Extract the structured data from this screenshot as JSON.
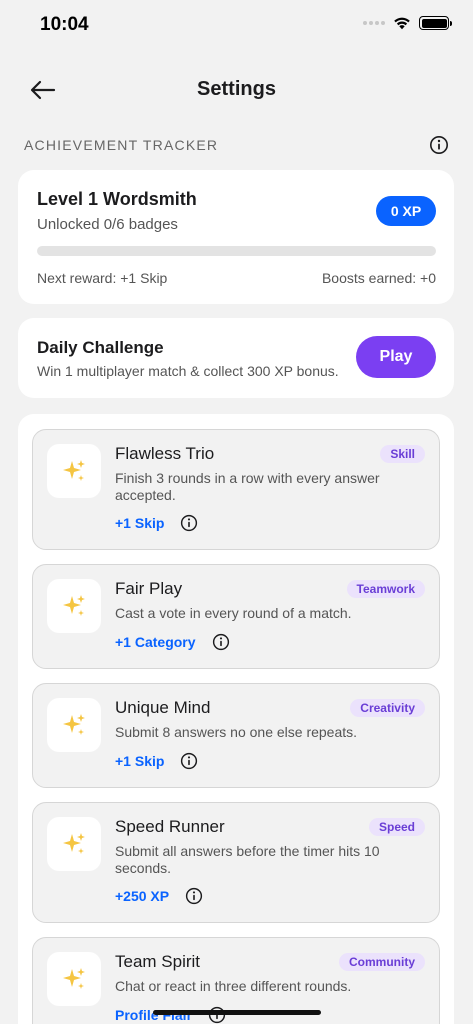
{
  "status_bar": {
    "time": "10:04"
  },
  "nav": {
    "title": "Settings"
  },
  "section": {
    "title": "ACHIEVEMENT TRACKER"
  },
  "tracker": {
    "title": "Level 1 Wordsmith",
    "subtitle": "Unlocked 0/6 badges",
    "xp": "0 XP",
    "progress": 0,
    "next_reward": "Next reward: +1 Skip",
    "boosts": "Boosts earned: +0"
  },
  "daily": {
    "title": "Daily Challenge",
    "subtitle": "Win 1 multiplayer match & collect 300 XP bonus.",
    "play_label": "Play"
  },
  "achievements": [
    {
      "title": "Flawless Trio",
      "tag": "Skill",
      "desc": "Finish 3 rounds in a row with every answer accepted.",
      "reward": "+1 Skip",
      "icon": "sparkles-icon"
    },
    {
      "title": "Fair Play",
      "tag": "Teamwork",
      "desc": "Cast a vote in every round of a match.",
      "reward": "+1 Category",
      "icon": "sparkles-icon"
    },
    {
      "title": "Unique Mind",
      "tag": "Creativity",
      "desc": "Submit 8 answers no one else repeats.",
      "reward": "+1 Skip",
      "icon": "sparkles-icon"
    },
    {
      "title": "Speed Runner",
      "tag": "Speed",
      "desc": "Submit all answers before the timer hits 10 seconds.",
      "reward": "+250 XP",
      "icon": "sparkles-icon"
    },
    {
      "title": "Team Spirit",
      "tag": "Community",
      "desc": "Chat or react in three different rounds.",
      "reward": "Profile Flair",
      "icon": "sparkles-icon"
    }
  ],
  "colors": {
    "accent": "#0a63ff",
    "play": "#7b3ff2",
    "tag_bg": "#ebe2fc",
    "tag_text": "#6a3ed6"
  }
}
